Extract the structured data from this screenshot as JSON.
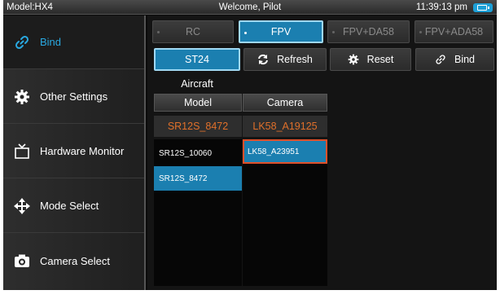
{
  "status_bar": {
    "model": "Model:HX4",
    "welcome": "Welcome, Pilot",
    "time": "11:39:13 pm"
  },
  "sidebar": {
    "items": [
      {
        "label": "Bind",
        "icon": "link-icon",
        "active": true
      },
      {
        "label": "Other Settings",
        "icon": "gear-icon",
        "active": false
      },
      {
        "label": "Hardware Monitor",
        "icon": "monitor-icon",
        "active": false
      },
      {
        "label": "Mode Select",
        "icon": "move-arrows-icon",
        "active": false
      },
      {
        "label": "Camera Select",
        "icon": "camera-icon",
        "active": false
      }
    ]
  },
  "modes": {
    "rc": "RC",
    "fpv": "FPV",
    "fpv_da58": "FPV+DA58",
    "fpv_ada58": "FPV+ADA58",
    "selected": "FPV"
  },
  "actions": {
    "st24": "ST24",
    "refresh": "Refresh",
    "reset": "Reset",
    "bind": "Bind"
  },
  "table": {
    "group_label": "Aircraft",
    "model_header": "Model",
    "camera_header": "Camera",
    "current_model": "SR12S_8472",
    "current_camera": "LK58_A19125",
    "model_list": [
      "SR12S_10060",
      "SR12S_8472"
    ],
    "camera_list": [
      "LK58_A23951"
    ]
  },
  "colors": {
    "accent_blue": "#1b7fb0",
    "active_text": "#29a8e0",
    "current_orange": "#e0702a",
    "selection_border_red": "#e0502a"
  }
}
